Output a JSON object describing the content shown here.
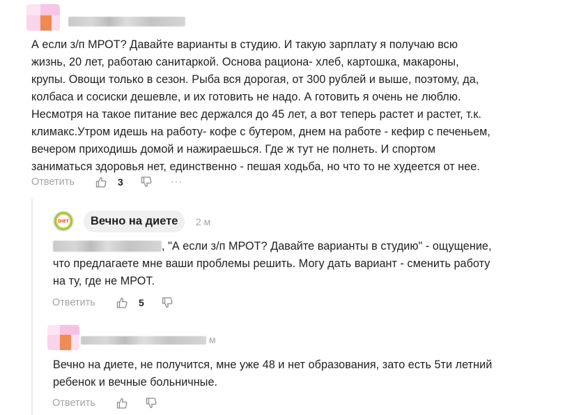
{
  "comment1": {
    "text_lines": [
      "А если з/п МРОТ? Давайте варианты в студию. И такую зарплату я получаю всю",
      "жизнь, 20 лет, работаю санитаркой. Основа рациона- хлеб, картошка, макароны,",
      "крупы. Овощи только в сезон. Рыба вся дорогая, от 300 рублей и выше, поэтому, да,",
      "колбаса и сосиски дешевле, и их готовить не надо. А готовить я очень не люблю.",
      "Несмотря на такое питание вес держался до 45 лет, а вот теперь растет и растет, т.к.",
      "климакс.Утром идешь на работу- кофе с бутером, днем на работе - кефир с печеньем,",
      "вечером приходишь домой и нажираешься. Где ж тут не полнеть. И спортом",
      "заниматься здоровья нет, единственно - пешая ходьба, но что то не худеется от нее."
    ],
    "reply_label": "Ответить",
    "like_count": "3",
    "more_label": "···"
  },
  "reply1": {
    "author": "Вечно на диете",
    "avatar_text": "DIET",
    "time": "2 м",
    "text_lines": [
      ", \"А если з/п МРОТ? Давайте варианты в студию\" - ощущение,",
      "что предлагаете мне ваши проблемы решить. Могу дать вариант - сменить работу",
      "на ту, где не МРОТ."
    ],
    "reply_label": "Ответить",
    "like_count": "5"
  },
  "reply2": {
    "time": "м",
    "text_lines": [
      "Вечно на диете, не получится, мне уже 48 и нет образования, зато есть 5ти летний",
      "ребенок и вечные больничные."
    ],
    "reply_label": "Ответить"
  },
  "colors": {
    "text": "#1f1f1f",
    "muted": "#a3a3a3",
    "chip_bg": "#f0f0f0",
    "thread_line": "#ebebeb"
  }
}
